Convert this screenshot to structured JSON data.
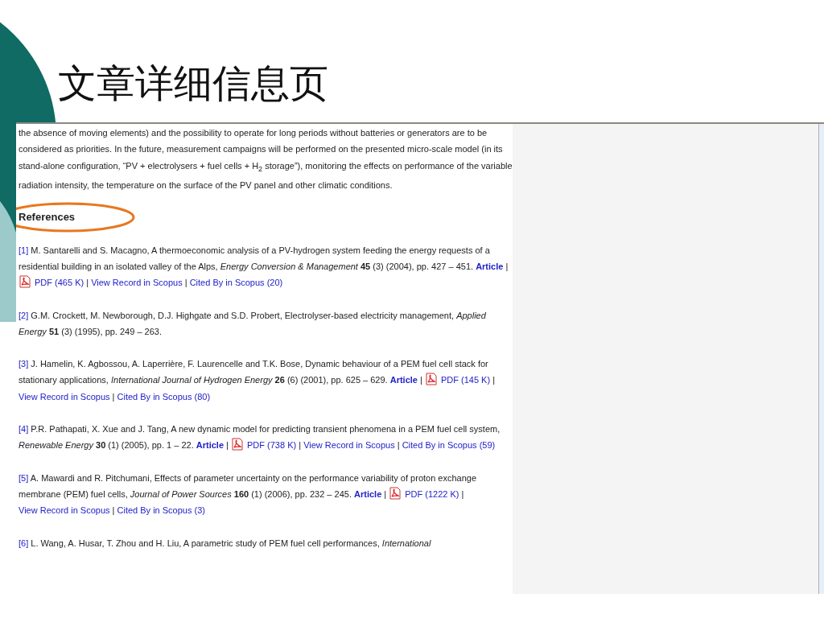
{
  "slide_title": "文章详细信息页",
  "article": {
    "paragraph": "the absence of moving elements) and the possibility to operate for long periods without batteries or generators are to be considered as priorities. In the future, measurement campaigns will be performed on the presented micro-scale model (in its stand-alone configuration, “PV + electrolysers + fuel cells + H$_{2}$ storage”), monitoring the effects on performance of the variable radiation intensity, the temperature on the surface of the PV panel and other climatic conditions.",
    "references_heading": "References",
    "highlight": {
      "kind": "ellipse",
      "color": "#e8771e"
    },
    "references": [
      {
        "number": "[1]",
        "text": "M. Santarelli and S. Macagno, A thermoeconomic analysis of a PV-hydrogen system feeding the energy requests of a residential building in an isolated valley of the Alps, *Energy Conversion & Management* **45** (3) (2004), pp. 427 – 451.",
        "links": [
          {
            "kind": "article",
            "label": "Article"
          },
          {
            "kind": "separator",
            "label": "|"
          },
          {
            "kind": "pdf",
            "label": "PDF (465 K)"
          },
          {
            "kind": "separator",
            "label": "|"
          },
          {
            "kind": "link",
            "label": "View Record in Scopus"
          },
          {
            "kind": "separator",
            "label": "|"
          },
          {
            "kind": "link",
            "label": "Cited By in Scopus (20)"
          }
        ]
      },
      {
        "number": "[2]",
        "text": "G.M. Crockett, M. Newborough, D.J. Highgate and S.D. Probert, Electrolyser-based electricity management, *Applied Energy* **51** (3) (1995), pp. 249 – 263."
      },
      {
        "number": "[3]",
        "text": "J. Hamelin, K. Agbossou, A. Laperrière, F. Laurencelle and T.K. Bose, Dynamic behaviour of a PEM fuel cell stack for stationary applications, *International Journal of Hydrogen Energy* **26** (6) (2001), pp. 625 – 629.",
        "links": [
          {
            "kind": "article",
            "label": "Article"
          },
          {
            "kind": "separator",
            "label": "|"
          },
          {
            "kind": "pdf",
            "label": "PDF (145 K)"
          },
          {
            "kind": "separator",
            "label": "|"
          },
          {
            "kind": "link",
            "label": "View Record in Scopus"
          },
          {
            "kind": "separator",
            "label": "|"
          },
          {
            "kind": "link",
            "label": "Cited By in Scopus (80)"
          }
        ]
      },
      {
        "number": "[4]",
        "text": "P.R. Pathapati, X. Xue and J. Tang, A new dynamic model for predicting transient phenomena in a PEM fuel cell system, *Renewable Energy* **30** (1) (2005), pp. 1 – 22.",
        "links": [
          {
            "kind": "article",
            "label": "Article"
          },
          {
            "kind": "separator",
            "label": "|"
          },
          {
            "kind": "pdf",
            "label": "PDF (738 K)"
          },
          {
            "kind": "separator",
            "label": "|"
          },
          {
            "kind": "link",
            "label": "View Record in Scopus"
          },
          {
            "kind": "separator",
            "label": "|"
          },
          {
            "kind": "link",
            "label": "Cited By in Scopus (59)"
          }
        ]
      },
      {
        "number": "[5]",
        "text": "A. Mawardi and R. Pitchumani, Effects of parameter uncertainty on the performance variability of proton exchange membrane (PEM) fuel cells, *Journal of Power Sources* **160** (1) (2006), pp. 232 – 245.",
        "links": [
          {
            "kind": "article",
            "label": "Article"
          },
          {
            "kind": "separator",
            "label": "|"
          },
          {
            "kind": "pdf",
            "label": "PDF (1222 K)"
          },
          {
            "kind": "separator",
            "label": "|"
          },
          {
            "kind": "link",
            "label": "View Record in Scopus"
          },
          {
            "kind": "separator",
            "label": "|"
          },
          {
            "kind": "link",
            "label": "Cited By in Scopus (3)"
          }
        ]
      },
      {
        "number": "[6]",
        "text": "L. Wang, A. Husar, T. Zhou and H. Liu, A parametric study of PEM fuel cell performances, *International*"
      }
    ]
  }
}
